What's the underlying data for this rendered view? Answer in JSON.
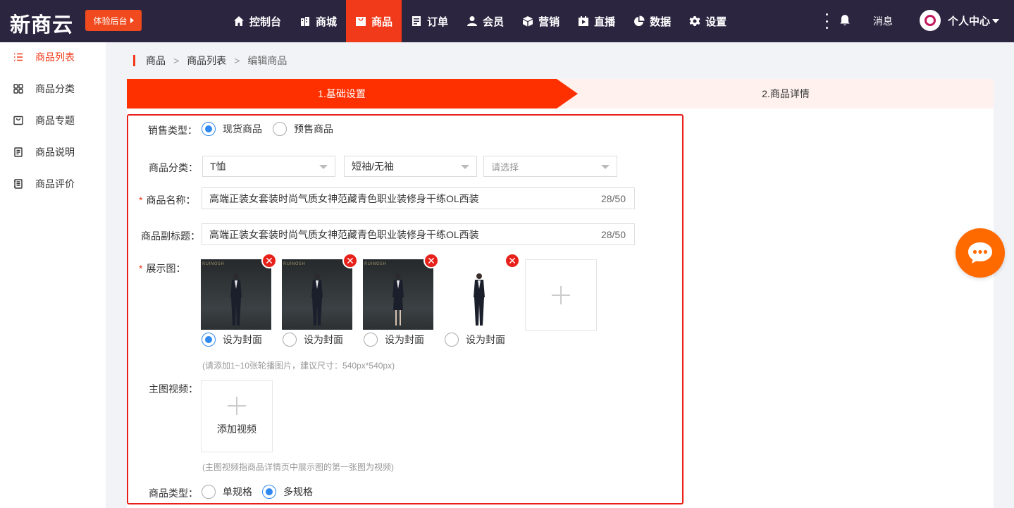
{
  "brand": {
    "logo": "新商云",
    "trial_button": "体验后台"
  },
  "nav": {
    "items": [
      {
        "label": "控制台",
        "icon": "home-icon"
      },
      {
        "label": "商城",
        "icon": "store-icon"
      },
      {
        "label": "商品",
        "icon": "bag-icon",
        "active": true
      },
      {
        "label": "订单",
        "icon": "order-icon"
      },
      {
        "label": "会员",
        "icon": "user-icon"
      },
      {
        "label": "营销",
        "icon": "cube-icon"
      },
      {
        "label": "直播",
        "icon": "live-icon"
      },
      {
        "label": "数据",
        "icon": "pie-icon"
      },
      {
        "label": "设置",
        "icon": "gear-icon"
      }
    ],
    "messages": "消息",
    "user_center": "个人中心"
  },
  "sidebar": {
    "items": [
      {
        "label": "商品列表",
        "icon": "list-icon",
        "active": true
      },
      {
        "label": "商品分类",
        "icon": "grid-icon"
      },
      {
        "label": "商品专题",
        "icon": "topic-icon"
      },
      {
        "label": "商品说明",
        "icon": "doc-icon"
      },
      {
        "label": "商品评价",
        "icon": "review-icon"
      }
    ]
  },
  "breadcrumb": {
    "level1": "商品",
    "level2": "商品列表",
    "current": "编辑商品",
    "separator": ">"
  },
  "steps": {
    "step1": "1.基础设置",
    "step2": "2.商品详情"
  },
  "form": {
    "sale_type": {
      "label": "销售类型：",
      "options": [
        "现货商品",
        "预售商品"
      ],
      "selected": "现货商品"
    },
    "category": {
      "label": "商品分类：",
      "level1": "T恤",
      "level2": "短袖/无袖",
      "level3_placeholder": "请选择"
    },
    "name": {
      "label": "商品名称：",
      "value": "高端正装女套装时尚气质女神范藏青色职业装修身干练OL西装",
      "counter": "28/50"
    },
    "subtitle": {
      "label": "商品副标题：",
      "value": "高端正装女套装时尚气质女神范藏青色职业装修身干练OL西装",
      "counter": "28/50"
    },
    "display_images": {
      "label": "展示图：",
      "brand_text": "RUINOSH",
      "cover_label": "设为封面",
      "cover_selected_index": 0,
      "hint": "(请添加1~10张轮播图片，建议尺寸：540px*540px)"
    },
    "main_video": {
      "label": "主图视频：",
      "add_label": "添加视频",
      "hint": "(主图视频指商品详情页中展示图的第一张图为视频)"
    },
    "product_type": {
      "label": "商品类型：",
      "options": [
        "单规格",
        "多规格"
      ],
      "selected": "多规格"
    }
  },
  "colors": {
    "accent": "#f13a1a",
    "topbar": "#2b2540",
    "radio": "#2f88f0",
    "fab": "#ff6a00"
  }
}
